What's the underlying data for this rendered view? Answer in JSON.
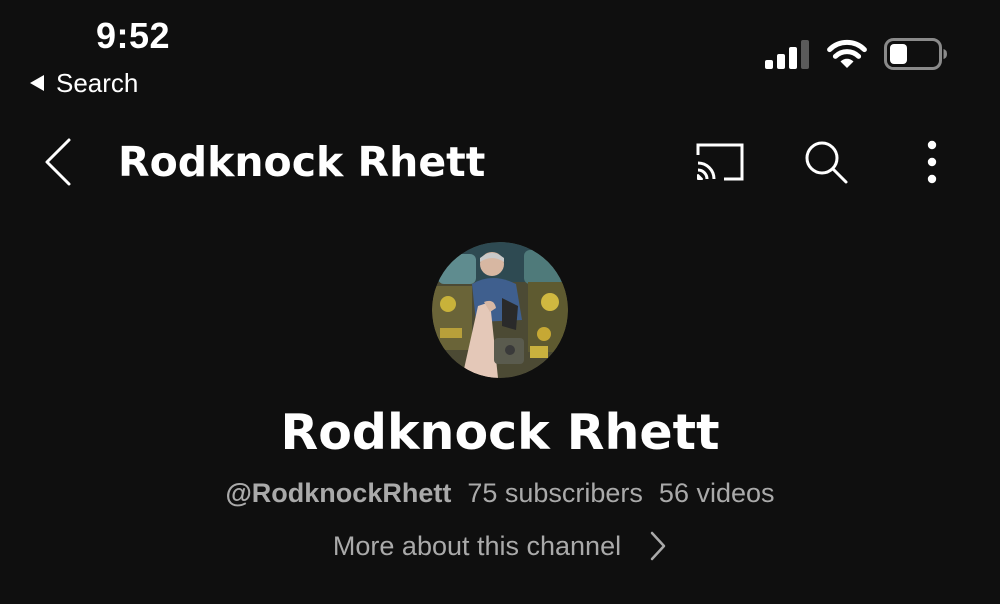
{
  "status_bar": {
    "time": "9:52",
    "back_to_app": "Search",
    "icons": [
      "cellular-signal-icon",
      "wifi-icon",
      "battery-icon"
    ],
    "signal_bars_active": 3,
    "signal_bars_total": 4,
    "battery_level": 0.35
  },
  "header": {
    "title": "Rodknock Rhett",
    "icons": [
      "back-chevron-icon",
      "cast-icon",
      "search-icon",
      "more-vert-icon"
    ]
  },
  "channel": {
    "name": "Rodknock Rhett",
    "handle": "@RodknockRhett",
    "subscribers": "75 subscribers",
    "videos": "56 videos",
    "more_about": "More about this channel"
  },
  "colors": {
    "background": "#0f0f0f",
    "primary_text": "#ffffff",
    "secondary_text": "#aaaaaa"
  }
}
